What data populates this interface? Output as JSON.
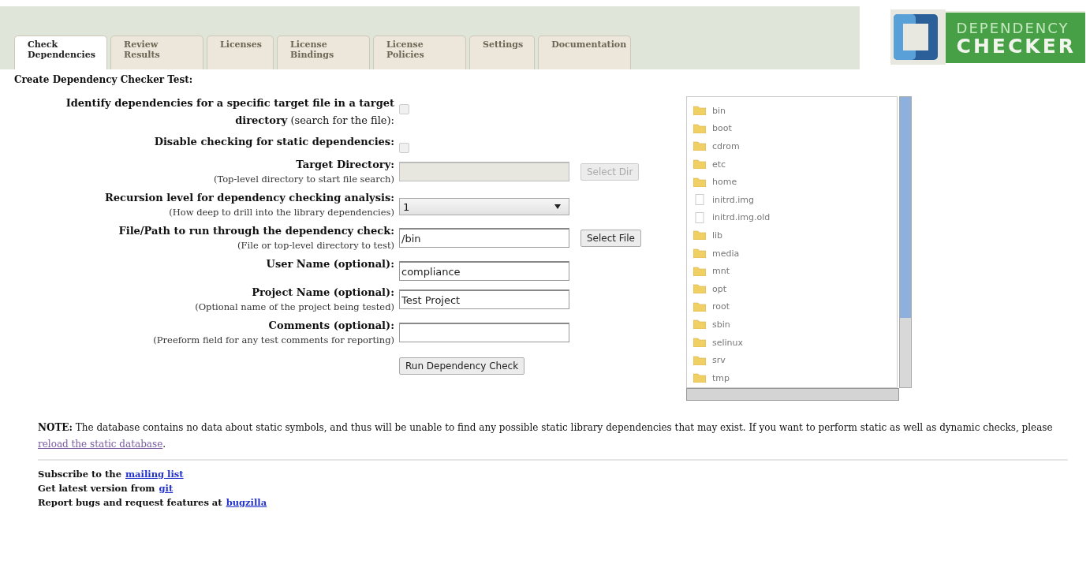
{
  "tabs": [
    {
      "label": "Check Dependencies",
      "selected": true
    },
    {
      "label": "Review Results",
      "selected": false
    },
    {
      "label": "Licenses",
      "selected": false
    },
    {
      "label": "License Bindings",
      "selected": false
    },
    {
      "label": "License Policies",
      "selected": false
    },
    {
      "label": "Settings",
      "selected": false
    },
    {
      "label": "Documentation",
      "selected": false
    }
  ],
  "logo": {
    "line1": "DEPENDENCY",
    "line2": "CHECKER"
  },
  "heading": "Create Dependency Checker Test:",
  "form": [
    {
      "kind": "checkbox",
      "label": "**Identify dependencies for a specific target file in a target directory** (search for the file):",
      "checked": false
    },
    {
      "kind": "checkbox",
      "label": "**Disable checking for static dependencies:**",
      "checked": false
    },
    {
      "kind": "text",
      "label": "Target Directory:",
      "hint": "(Top-level directory to start file search)",
      "disabled": true,
      "button": "Select Dir"
    },
    {
      "kind": "select",
      "label": "Recursion level for dependency checking analysis:",
      "hint": "(How deep to drill into the library dependencies)",
      "value": "1"
    },
    {
      "kind": "text",
      "label": "File/Path to run through the dependency check:",
      "hint": "(File or top-level directory to test)",
      "disabled": false,
      "value": "/bin",
      "button": "Select File"
    },
    {
      "kind": "text",
      "label": "User Name (optional):",
      "disabled": false,
      "value": "compliance"
    },
    {
      "kind": "text",
      "label": "Project Name (optional):",
      "hint": "(Optional name of the project being tested)",
      "disabled": false,
      "value": "Test Project"
    },
    {
      "kind": "text",
      "label": "Comments (optional):",
      "hint": "(Preeform field for any test comments for reporting)",
      "disabled": false
    }
  ],
  "submit": "Run Dependency Check",
  "files": [
    {
      "name": "bin",
      "kind": "folder"
    },
    {
      "name": "boot",
      "kind": "folder"
    },
    {
      "name": "cdrom",
      "kind": "folder"
    },
    {
      "name": "etc",
      "kind": "folder"
    },
    {
      "name": "home",
      "kind": "folder"
    },
    {
      "name": "initrd.img",
      "kind": "file"
    },
    {
      "name": "initrd.img.old",
      "kind": "file"
    },
    {
      "name": "lib",
      "kind": "folder"
    },
    {
      "name": "media",
      "kind": "folder"
    },
    {
      "name": "mnt",
      "kind": "folder"
    },
    {
      "name": "opt",
      "kind": "folder"
    },
    {
      "name": "root",
      "kind": "folder"
    },
    {
      "name": "sbin",
      "kind": "folder"
    },
    {
      "name": "selinux",
      "kind": "folder"
    },
    {
      "name": "srv",
      "kind": "folder"
    },
    {
      "name": "tmp",
      "kind": "folder"
    }
  ],
  "note": {
    "before": "**NOTE:** The database contains no data about static symbols, and thus will be unable to find any possible static library dependencies that may exist. If you want to perform static as well as dynamic checks, please ",
    "link": "reload the static database",
    "after": "."
  },
  "footer": [
    {
      "text": "Subscribe to the",
      "link": "mailing list"
    },
    {
      "text": "Get latest version from",
      "link": "git"
    },
    {
      "text": "Report bugs and request features at",
      "link": "bugzilla"
    }
  ]
}
